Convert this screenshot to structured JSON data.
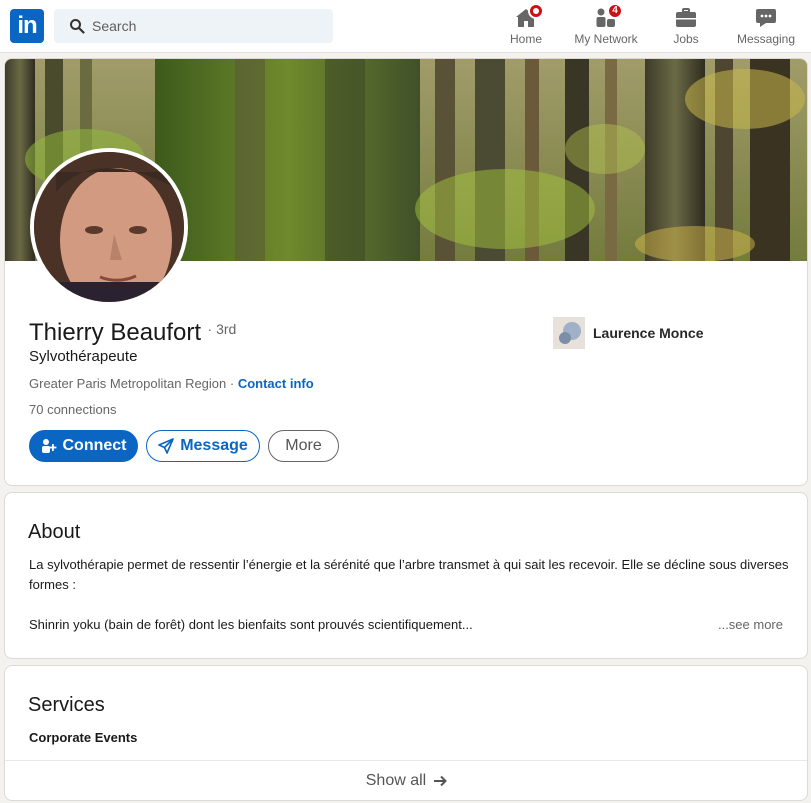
{
  "header": {
    "logo_text": "in",
    "search_placeholder": "Search",
    "nav": [
      {
        "label": "Home",
        "icon": "home-icon",
        "badge": ""
      },
      {
        "label": "My Network",
        "icon": "people-icon",
        "badge": "4"
      },
      {
        "label": "Jobs",
        "icon": "briefcase-icon",
        "badge": ""
      },
      {
        "label": "Messaging",
        "icon": "chat-icon",
        "badge": ""
      }
    ]
  },
  "profile": {
    "name": "Thierry Beaufort",
    "degree": "· 3rd",
    "headline": "Sylvothérapeute",
    "location": "Greater Paris Metropolitan Region ·",
    "contact_info": "Contact info",
    "connections": "70 connections",
    "company": "Laurence Monce",
    "actions": {
      "connect": "Connect",
      "message": "Message",
      "more": "More"
    }
  },
  "about": {
    "title": "About",
    "paragraph1": "La sylvothérapie permet de ressentir l’énergie et la sérénité que l’arbre transmet à qui sait les recevoir. Elle se décline sous diverses formes :",
    "paragraph2": "Shinrin yoku (bain de forêt) dont les bienfaits sont prouvés scientifiquement...",
    "see_more": "...see more"
  },
  "services": {
    "title": "Services",
    "items": [
      "Corporate Events"
    ],
    "show_all": "Show all"
  },
  "colors": {
    "brand": "#0a66c2",
    "badge": "#cc1016",
    "page_bg": "#f3f2ef"
  }
}
